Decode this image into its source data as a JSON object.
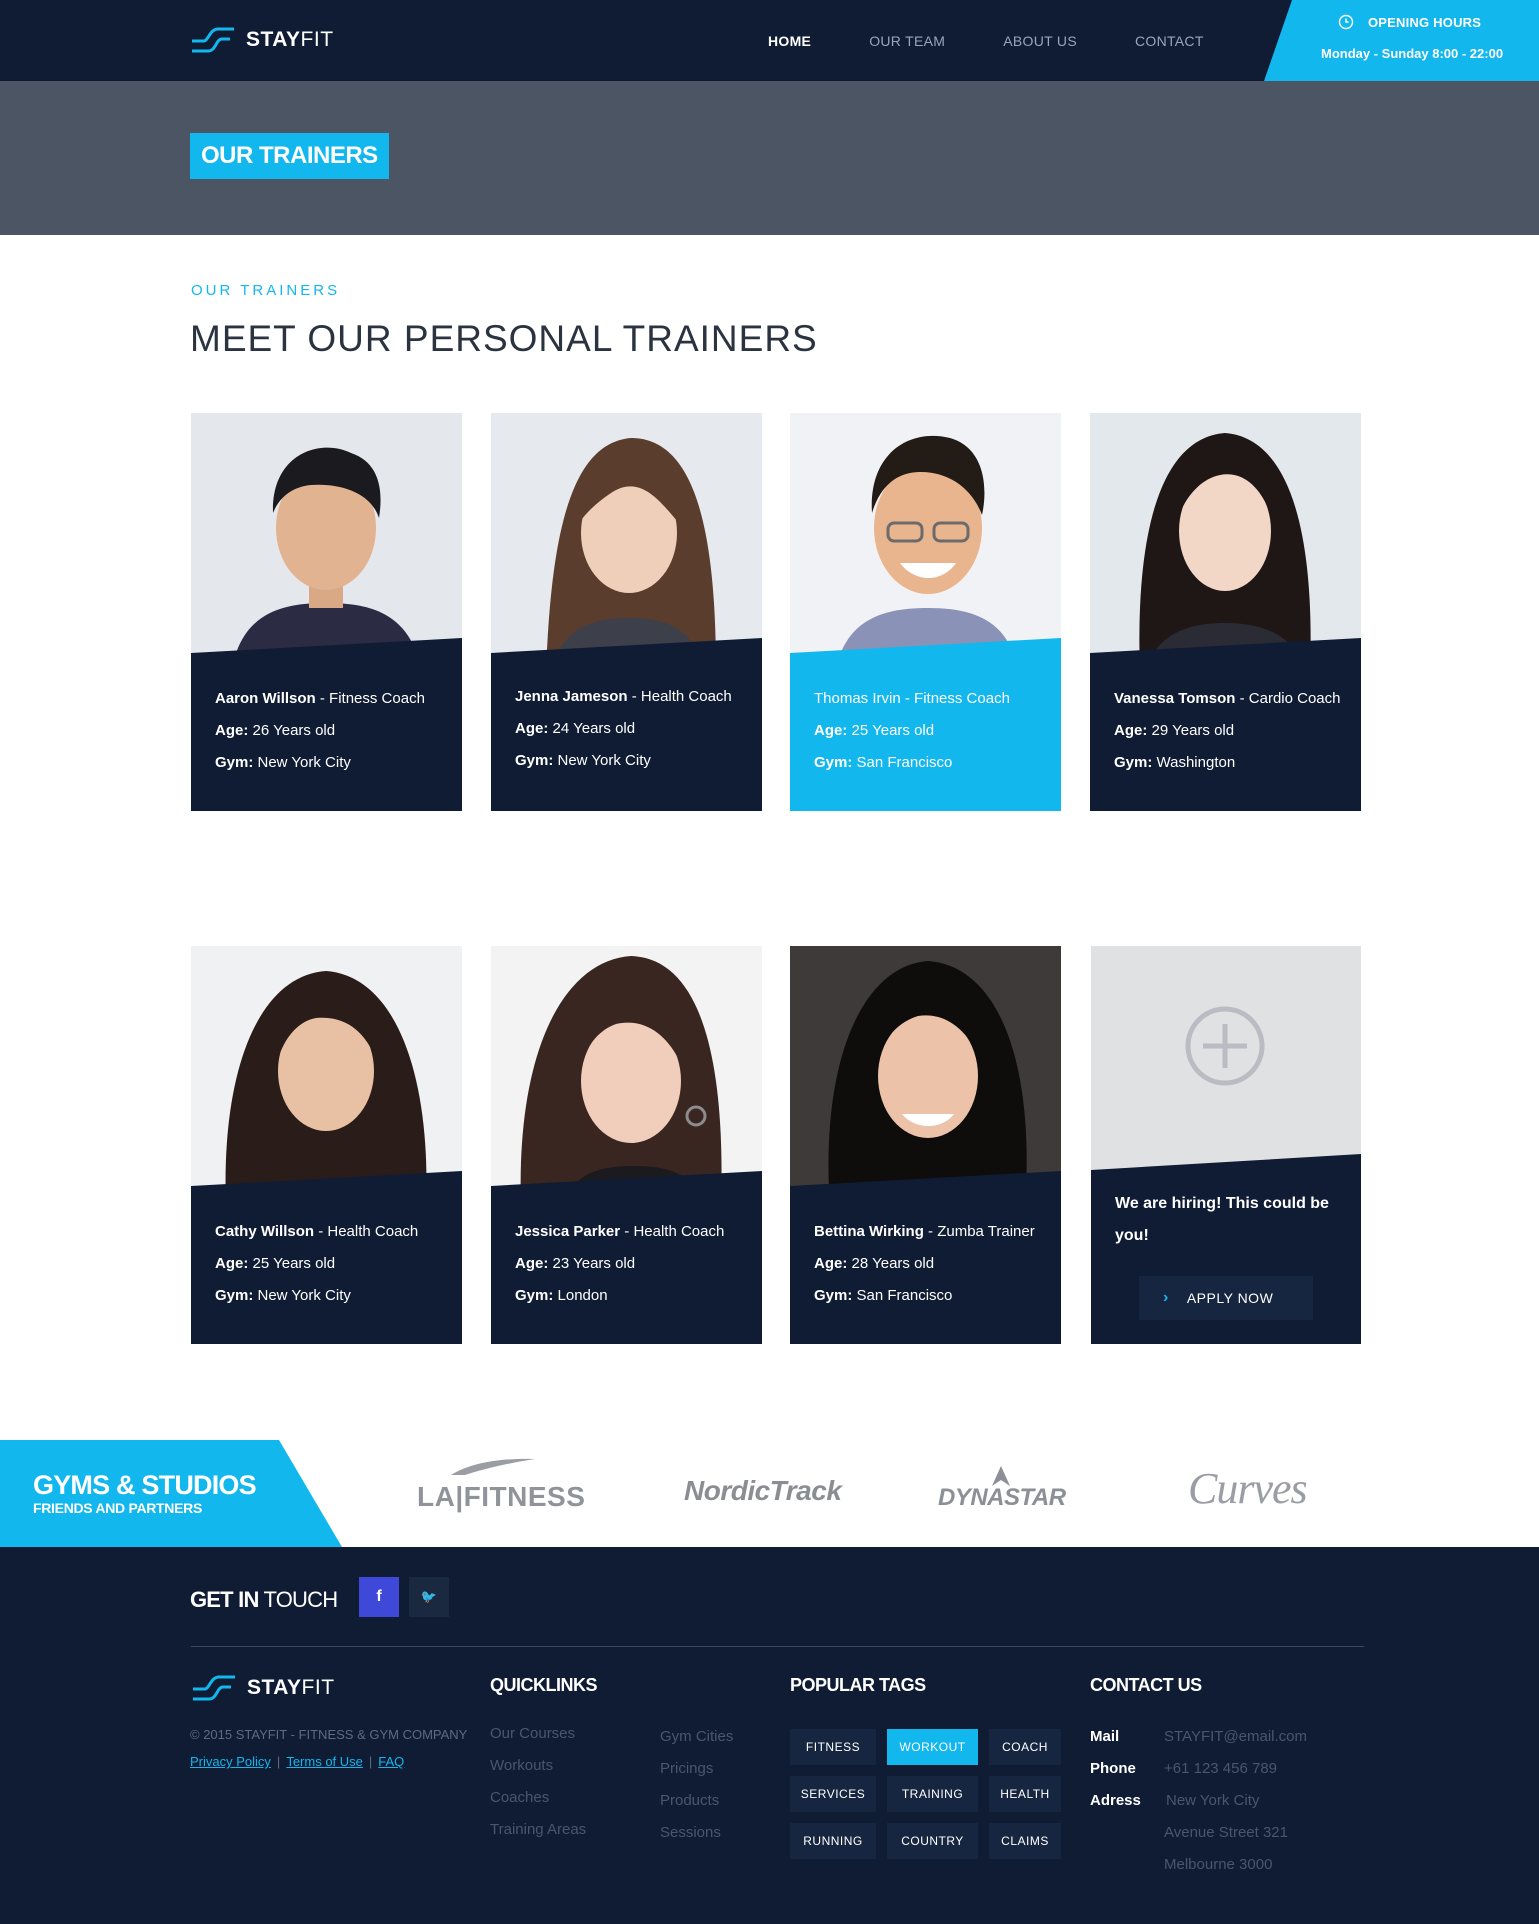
{
  "colors": {
    "navy": "#0f1c34",
    "accent": "#12b7ee",
    "banner": "#4c5563"
  },
  "brand": {
    "name_bold": "STAY",
    "name_light": "FIT"
  },
  "nav": {
    "items": [
      {
        "label": "HOME",
        "active": true
      },
      {
        "label": "OUR TEAM"
      },
      {
        "label": "ABOUT US"
      },
      {
        "label": "CONTACT"
      }
    ]
  },
  "hours": {
    "icon": "clock-icon",
    "title": "OPENING HOURS",
    "value": "Monday - Sunday 8:00 - 22:00"
  },
  "banner": {
    "title": "OUR TRAINERS"
  },
  "section": {
    "eyebrow": "OUR TRAINERS",
    "title": "MEET OUR PERSONAL TRAINERS"
  },
  "labels": {
    "age": "Age:",
    "gym": "Gym:"
  },
  "trainers": [
    {
      "name": "Aaron Willson",
      "role": " - Fitness Coach",
      "age": " 26 Years old",
      "gym": " New York City"
    },
    {
      "name": "Jenna Jameson",
      "role": " - Health Coach",
      "age": " 24 Years old",
      "gym": " New York City"
    },
    {
      "name": "Thomas Irvin",
      "role": " - Fitness Coach",
      "age": " 25 Years old",
      "gym": " San Francisco",
      "highlighted": true
    },
    {
      "name": "Vanessa Tomson",
      "role": " - Cardio Coach",
      "age": " 29 Years old",
      "gym": " Washington"
    },
    {
      "name": "Cathy Willson",
      "role": " - Health Coach",
      "age": " 25 Years old",
      "gym": " New York City"
    },
    {
      "name": "Jessica Parker",
      "role": " - Health Coach",
      "age": " 23 Years old",
      "gym": " London"
    },
    {
      "name": "Bettina Wirking",
      "role": " - Zumba Trainer",
      "age": " 28 Years old",
      "gym": " San Francisco"
    }
  ],
  "hiring": {
    "icon": "plus-circle-icon",
    "text": "We are hiring! This could be you!",
    "button": "APPLY NOW"
  },
  "partners": {
    "title": "GYMS & STUDIOS",
    "subtitle": "FRIENDS AND PARTNERS",
    "logos": [
      "LA|FITNESS",
      "NordicTrack",
      "DYNASTAR",
      "Curves"
    ]
  },
  "footer": {
    "get_in_touch_bold": "GET IN",
    "get_in_touch_light": " TOUCH",
    "social": [
      {
        "icon": "facebook-icon",
        "glyph": "f"
      },
      {
        "icon": "twitter-icon",
        "glyph": "🐦"
      }
    ],
    "copyright": "© 2015 STAYFIT - FITNESS & GYM COMPANY",
    "legal": [
      "Privacy Policy",
      "Terms of Use",
      "FAQ"
    ],
    "quicklinks_title": "QUICKLINKS",
    "quicklinks_col1": [
      "Our Courses",
      "Workouts",
      "Coaches",
      "Training Areas"
    ],
    "quicklinks_col2": [
      "Gym Cities",
      "Pricings",
      "Products",
      "Sessions"
    ],
    "tags_title": "POPULAR TAGS",
    "tags": [
      {
        "label": "FITNESS"
      },
      {
        "label": "WORKOUT",
        "active": true
      },
      {
        "label": "COACH"
      },
      {
        "label": "SERVICES"
      },
      {
        "label": "TRAINING"
      },
      {
        "label": "HEALTH"
      },
      {
        "label": "RUNNING"
      },
      {
        "label": "COUNTRY"
      },
      {
        "label": "CLAIMS"
      }
    ],
    "contact_title": "CONTACT US",
    "contact": {
      "mail_label": "Mail",
      "mail": "STAYFIT@email.com",
      "phone_label": "Phone",
      "phone": "+61 123 456 789",
      "address_label": "Adress",
      "address": [
        "New York City",
        "Avenue Street 321",
        "Melbourne 3000"
      ]
    }
  }
}
